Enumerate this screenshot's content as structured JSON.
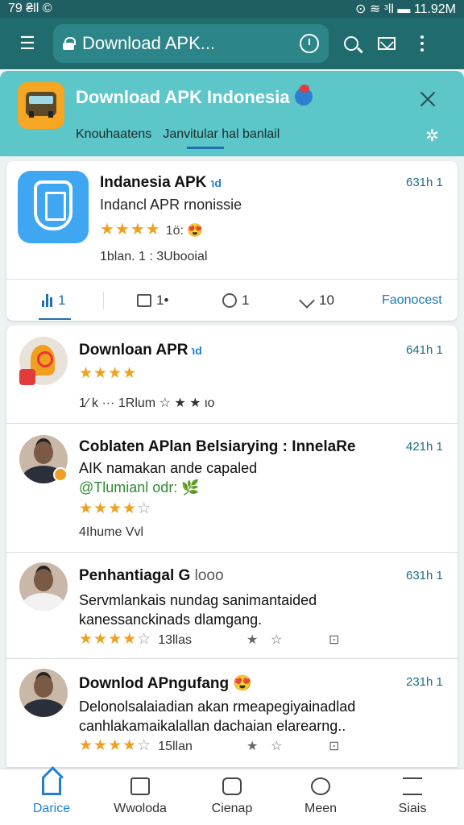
{
  "status_bar": {
    "left": "79 ₴ll ©",
    "right": "⊙ ≋ ᵌll ▬ 11.92M"
  },
  "toolbar": {
    "url_text": "Download APK..."
  },
  "banner": {
    "title": "Download APK Indonesia",
    "tabs": [
      "Knouhaatens",
      "Janvitular hal banlail"
    ]
  },
  "featured": {
    "title": "Indanesia APK",
    "tag": "℩d",
    "subtitle": "Indancl APR rnonissie",
    "stars": "★★★★",
    "stars_tail": "1ö: 😍",
    "meta": "1blan. 1 : 3Ubooial",
    "time": "631h 1",
    "actions": [
      {
        "label": "1"
      },
      {
        "label": "1•"
      },
      {
        "label": "1"
      },
      {
        "label": "10"
      },
      {
        "label": "Faonocest"
      }
    ]
  },
  "posts": [
    {
      "title": "Downloan APR",
      "tag": "℩d",
      "time": "641h 1",
      "stars": "★★★★",
      "meta": "1⁄ k  ···    1Rlum  ☆          ★   ★              ιo"
    },
    {
      "title": "Coblaten APlan Belsiarying : InnelaRe",
      "time": "421h 1",
      "text_line1": "AIK namakan ande capaled",
      "highlight": "@Tlumianl odr: 🌿",
      "stars": "★★★★",
      "stars_dim": "☆",
      "meta": "4Ihume  Vvl"
    },
    {
      "title": "Penhantiagal G",
      "title_lite": "looo",
      "time": "631h 1",
      "text_line1": "Servmlankais nundag sanimantaided",
      "text_line2": "kanessanckinads dlamgang.",
      "stars": "★★★★",
      "stars_dim": "☆",
      "stars_tail": "13llas",
      "icons": [
        "★",
        "☆",
        "⊡"
      ]
    },
    {
      "title": "Downlod APngufang 😍",
      "time": "231h 1",
      "text_line1": "Delonolsalaiadian akan rmeapegiyainadlad",
      "text_line2": "canhlakamaikalallan dachaian elarearng..",
      "stars": "★★★★",
      "stars_dim": "☆",
      "stars_tail": "15llan",
      "icons": [
        "★",
        "☆",
        "⊡"
      ]
    }
  ],
  "bottom_nav": [
    {
      "label": "Darice"
    },
    {
      "label": "Wwoloda"
    },
    {
      "label": "Cienap"
    },
    {
      "label": "Meen"
    },
    {
      "label": "Siais"
    }
  ]
}
